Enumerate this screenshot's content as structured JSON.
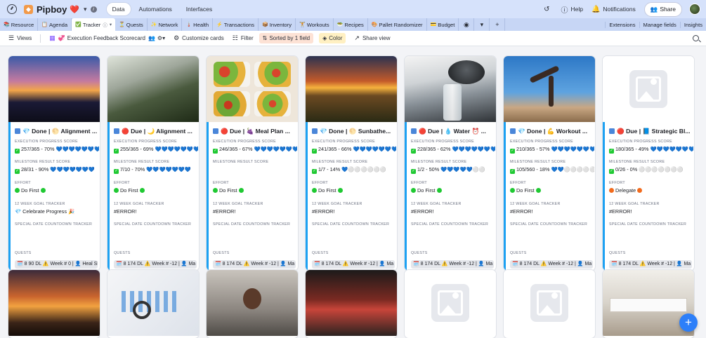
{
  "app": {
    "base_name": "Pipboy",
    "base_emoji": "❤️",
    "top_tabs": [
      "Data",
      "Automations",
      "Interfaces"
    ],
    "help": "Help",
    "notifications": "Notifications",
    "share": "Share"
  },
  "tables": [
    {
      "label": "Resource",
      "sub": ""
    },
    {
      "label": "Agenda",
      "sub": ""
    },
    {
      "label": "Tracker",
      "sub": ""
    },
    {
      "label": "Quests",
      "sub": ""
    },
    {
      "label": "Network",
      "sub": ""
    },
    {
      "label": "Health",
      "sub": ""
    },
    {
      "label": "Transactions",
      "sub": ""
    },
    {
      "label": "Inventory",
      "sub": ""
    },
    {
      "label": "Workouts",
      "sub": ""
    },
    {
      "label": "Recipes",
      "sub": ""
    },
    {
      "label": "Pallet Randomizer",
      "sub": ""
    },
    {
      "label": "Budget",
      "sub": ""
    }
  ],
  "active_table_index": 2,
  "tab_right": [
    "Extensions",
    "Manage fields",
    "Insights"
  ],
  "viewbar": {
    "views": "Views",
    "view_name": "Execution Feedback Scorecard",
    "customize": "Customize cards",
    "filter": "Filter",
    "sort": "Sorted by 1 field",
    "color": "Color",
    "share": "Share view"
  },
  "field_labels": {
    "exec": "EXECUTION PROGRESS SCORE",
    "milestone": "MILESTONE RESULT SCORE",
    "effort": "EFFORT",
    "goal": "12 WEEK GOAL TRACKER",
    "special": "SPECIAL DATE COUNTDOWN TRACKER",
    "quests": "QUESTS"
  },
  "cards": [
    {
      "title": "💎 Done | 🌕 Alignment ...",
      "exec": "257/365 - 70% 💙💙💙💙💙💙💙",
      "milestone": "28/31 - 90% 💙💙💙💙💙💙💙",
      "effort": "Do First",
      "effort_color": "g",
      "goal": "💎 Celebrate Progress 🎉",
      "quest": "🗓️ 8 90 DL ⚠️ Week # 0 | 👤 Heal Sl"
    },
    {
      "title": "🔴 Due | 🌙 Alignment ...",
      "exec": "255/365 - 69% 💙💙💙💙💙💙💙",
      "milestone": "7/10 - 70% 💙💙💙💙💙💙💙",
      "effort": "Do First",
      "effort_color": "g",
      "goal": "#ERROR!",
      "quest": "🗓️ 8 174 DL ⚠️ Week # -12 | 👤 Ma"
    },
    {
      "title": "🔴 Due | 🍇 Meal Plan ...",
      "exec": "246/365 - 67% 💙💙💙💙💙💙💙",
      "milestone": "",
      "effort": "Do First",
      "effort_color": "g",
      "goal": "#ERROR!",
      "quest": "🗓️ 8 174 DL ⚠️ Week # -12 | 👤 Ma"
    },
    {
      "title": "💎 Done | 🌕 Sunbathe...",
      "exec": "241/365 - 66% 💙💙💙💙💙💙💙",
      "milestone": "1/7 - 14% 💙⚪⚪⚪⚪⚪⚪",
      "effort": "Do First",
      "effort_color": "g",
      "goal": "#ERROR!",
      "quest": "🗓️ 8 174 DL ⚠️ Week # -12 | 👤 Ma"
    },
    {
      "title": "🔴 Due | 💧 Water ⏰ ...",
      "exec": "228/365 - 62% 💙💙💙💙💙💙💙",
      "milestone": "1/2 - 50% 💙💙💙💙💙⚪⚪",
      "effort": "Do First",
      "effort_color": "g",
      "goal": "#ERROR!",
      "quest": "🗓️ 8 174 DL ⚠️ Week # -12 | 👤 Ma"
    },
    {
      "title": "💎 Done | 💪 Workout ...",
      "exec": "210/365 - 57% 💙💙💙💙💙💙💙",
      "milestone": "105/560 - 18% 💙💙⚪⚪⚪⚪⚪",
      "effort": "Do First",
      "effort_color": "g",
      "goal": "#ERROR!",
      "quest": "🗓️ 8 174 DL ⚠️ Week # -12 | 👤 Ma"
    },
    {
      "title": "🔴 Due | 📘 Strategic Bl...",
      "exec": "180/365 - 49% 💙💙💙💙💙💙💙",
      "milestone": "0/26 - 0% ⚪⚪⚪⚪⚪⚪⚪",
      "effort": "Delegate",
      "effort_color": "o",
      "goal": "#ERROR!",
      "quest": "🗓️ 8 174 DL ⚠️ Week # -12 | 👤 Ma"
    }
  ]
}
